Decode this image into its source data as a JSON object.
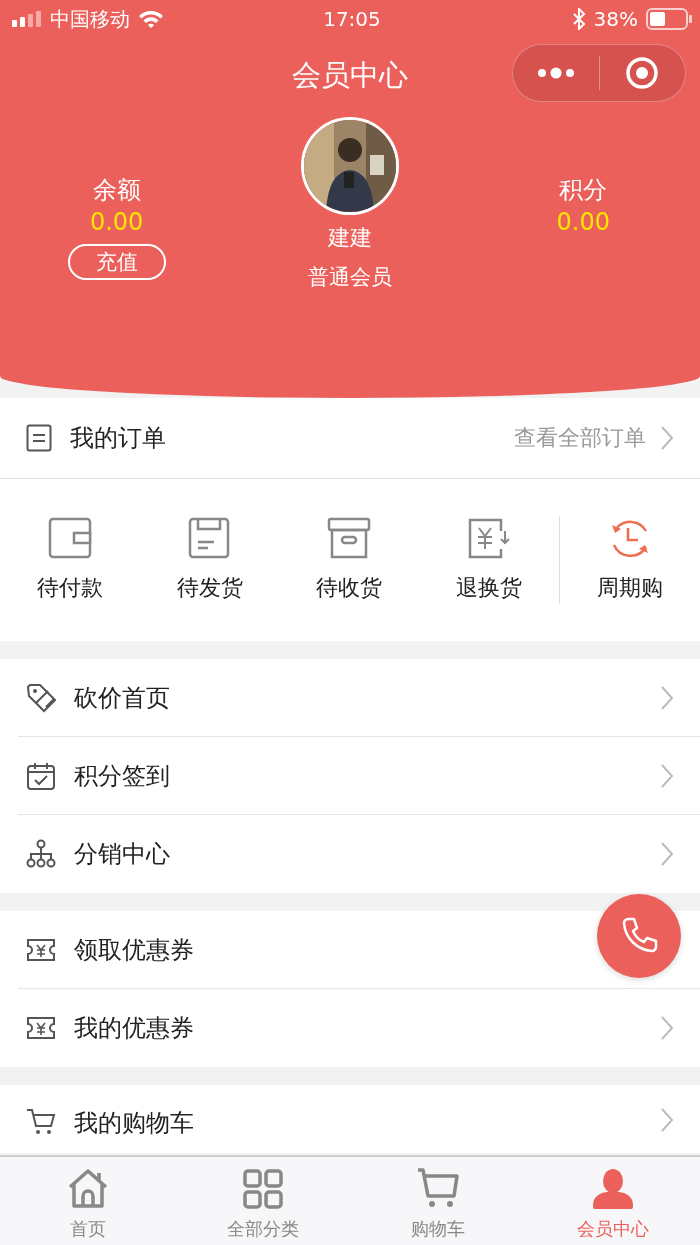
{
  "status_bar": {
    "carrier": "中国移动",
    "time": "17:05",
    "battery": "38%"
  },
  "nav": {
    "title": "会员中心"
  },
  "profile": {
    "balance": {
      "label": "余额",
      "value": "0.00",
      "button": "充值"
    },
    "name": "建建",
    "level": "普通会员",
    "points": {
      "label": "积分",
      "value": "0.00"
    }
  },
  "orders": {
    "title": "我的订单",
    "link": "查看全部订单",
    "items": [
      {
        "label": "待付款",
        "kind": "status"
      },
      {
        "label": "待发货",
        "kind": "status"
      },
      {
        "label": "待收货",
        "kind": "status"
      },
      {
        "label": "退换货",
        "kind": "status"
      },
      {
        "label": "周期购",
        "kind": "special"
      }
    ]
  },
  "menu_groups": [
    [
      {
        "label": "砍价首页",
        "chevron": true
      },
      {
        "label": "积分签到",
        "chevron": true
      },
      {
        "label": "分销中心",
        "chevron": true
      }
    ],
    [
      {
        "label": "领取优惠券",
        "chevron": false
      },
      {
        "label": "我的优惠券",
        "chevron": true
      }
    ],
    [
      {
        "label": "我的购物车",
        "chevron": true
      }
    ]
  ],
  "tab_bar": [
    {
      "label": "首页",
      "selected": false
    },
    {
      "label": "全部分类",
      "selected": false
    },
    {
      "label": "购物车",
      "selected": false
    },
    {
      "label": "会员中心",
      "selected": true
    }
  ]
}
